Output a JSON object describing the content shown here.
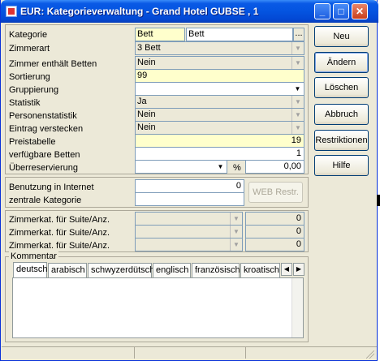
{
  "window": {
    "title": "EUR: Kategorieverwaltung - Grand Hotel GUBSE , 1",
    "minimize_glyph": "_",
    "maximize_glyph": "□",
    "close_glyph": "✕"
  },
  "form": {
    "kategorie": {
      "label": "Kategorie",
      "code": "Bett",
      "name": "Bett",
      "browse_glyph": "..."
    },
    "zimmerart": {
      "label": "Zimmerart",
      "value": "3 Bett"
    },
    "zimmer_enthaelt_betten": {
      "label": "Zimmer enthält Betten",
      "value": "Nein"
    },
    "sortierung": {
      "label": "Sortierung",
      "value": "99"
    },
    "gruppierung": {
      "label": "Gruppierung",
      "value": ""
    },
    "statistik": {
      "label": "Statistik",
      "value": "Ja"
    },
    "personenstatistik": {
      "label": "Personenstatistik",
      "value": "Nein"
    },
    "eintrag_verstecken": {
      "label": "Eintrag verstecken",
      "value": "Nein"
    },
    "preistabelle": {
      "label": "Preistabelle",
      "value": "19"
    },
    "verfuegbare_betten": {
      "label": "verfügbare Betten",
      "value": "1"
    },
    "ueberreservierung": {
      "label": "Überreservierung",
      "combo_value": "",
      "unit": "%",
      "value": "0,00"
    }
  },
  "internet": {
    "benutzung_label": "Benutzung in Internet",
    "benutzung_value": "0",
    "zentrale_label": "zentrale Kategorie",
    "zentrale_value": "",
    "web_button": "WEB Restr."
  },
  "suites": [
    {
      "label": "Zimmerkat. für Suite/Anz.",
      "combo": "",
      "value": "0"
    },
    {
      "label": "Zimmerkat. für Suite/Anz.",
      "combo": "",
      "value": "0"
    },
    {
      "label": "Zimmerkat. für Suite/Anz.",
      "combo": "",
      "value": "0"
    }
  ],
  "kommentar": {
    "label": "Kommentar",
    "tabs": [
      "deutsch",
      "arabisch",
      "schwyzerdütsch",
      "englisch",
      "französisch",
      "kroatisch"
    ],
    "selected_tab": "deutsch",
    "text": ""
  },
  "buttons": {
    "neu": "Neu",
    "aendern": "Ändern",
    "loeschen": "Löschen",
    "abbruch": "Abbruch",
    "restriktionen": "Restriktionen",
    "hilfe": "Hilfe"
  },
  "colors": {
    "titlebar": "#0454e0",
    "window_bg": "#ece9d8",
    "highlight_field": "#ffffcc"
  }
}
